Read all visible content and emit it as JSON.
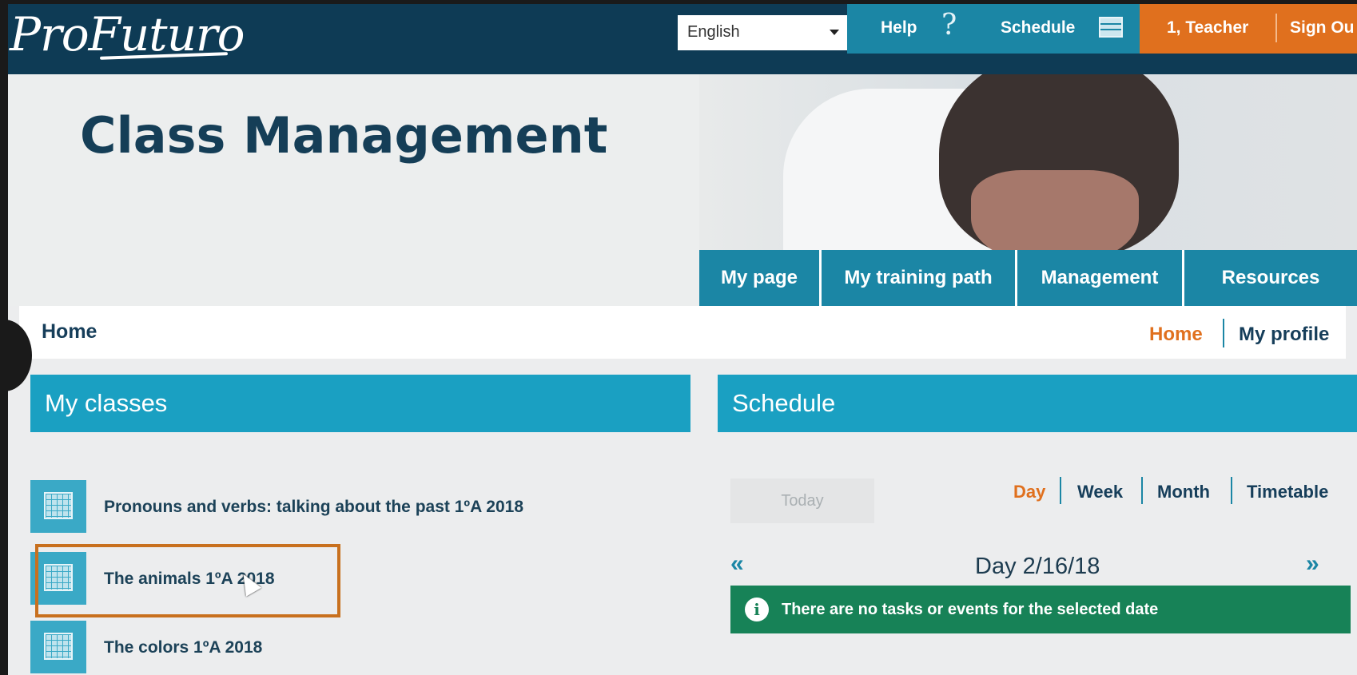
{
  "header": {
    "logo_text": "ProFuturo",
    "language": "English",
    "help_label": "Help",
    "schedule_label": "Schedule",
    "user_label": "1, Teacher",
    "signout_label": "Sign Ou"
  },
  "hero": {
    "title": "Class Management"
  },
  "main_nav": [
    "My page",
    "My training path",
    "Management",
    "Resources"
  ],
  "breadcrumb": {
    "current": "Home",
    "home_link": "Home",
    "profile_link": "My profile"
  },
  "classes": {
    "title": "My classes",
    "items": [
      "Pronouns and verbs: talking about the past 1ºA 2018",
      "The animals 1ºA 2018",
      "The colors 1ºA 2018"
    ]
  },
  "schedule": {
    "title": "Schedule",
    "today_label": "Today",
    "views": [
      "Day",
      "Week",
      "Month",
      "Timetable"
    ],
    "prev_label": "«",
    "next_label": "»",
    "day_label": "Day 2/16/18",
    "empty_message": "There are no tasks or events for the selected date"
  },
  "colors": {
    "navy": "#0e3b55",
    "teal": "#1b86a5",
    "orange": "#e0701e",
    "green": "#178257"
  },
  "icons": {
    "help": "question-icon",
    "schedule": "calendar-icon",
    "class": "calendar-grid-icon",
    "info": "info-icon"
  }
}
